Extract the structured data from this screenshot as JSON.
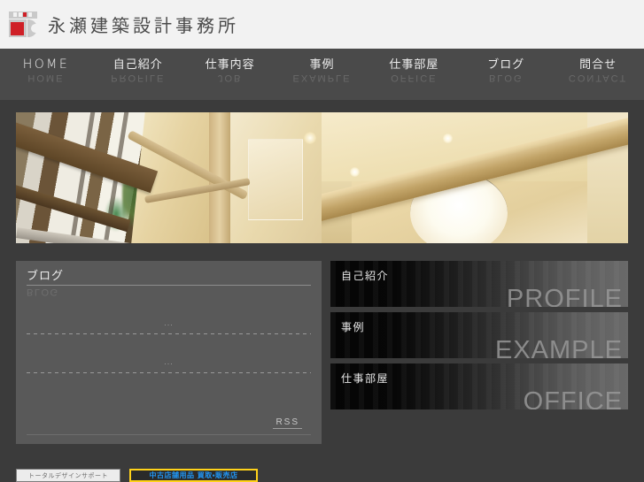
{
  "header": {
    "site_title": "永瀬建築設計事務所",
    "logo_icon": "architect-logo-mark"
  },
  "nav": {
    "items": [
      {
        "ja": "HOME",
        "en": "HOME",
        "is_en": true
      },
      {
        "ja": "自己紹介",
        "en": "PROFILE",
        "is_en": false
      },
      {
        "ja": "仕事内容",
        "en": "JOB",
        "is_en": false
      },
      {
        "ja": "事例",
        "en": "EXAMPLE",
        "is_en": false
      },
      {
        "ja": "仕事部屋",
        "en": "OFFICE",
        "is_en": false
      },
      {
        "ja": "ブログ",
        "en": "BLOG",
        "is_en": false
      },
      {
        "ja": "問合せ",
        "en": "CONTACT",
        "is_en": false
      }
    ]
  },
  "hero": {
    "left_alt": "architectural-interior-glass-facade",
    "right_alt": "architectural-interior-ceiling-beam"
  },
  "blog": {
    "title": "ブログ",
    "subtitle": "BLOG",
    "entries": [
      {
        "text": "..."
      },
      {
        "text": "..."
      }
    ],
    "rss_label": "RSS"
  },
  "panels": [
    {
      "ja": "自己紹介",
      "en": "PROFILE"
    },
    {
      "ja": "事例",
      "en": "EXAMPLE"
    },
    {
      "ja": "仕事部屋",
      "en": "OFFICE"
    }
  ],
  "banners": [
    {
      "label": "トータルデザインサポート",
      "style": "light"
    },
    {
      "label": "中古店舗用品 買取・販売店",
      "style": "yellow"
    }
  ],
  "colors": {
    "header_bg": "#f2f2f2",
    "nav_bg": "#4a4a4a",
    "page_bg": "#3b3b3b",
    "panel_bg": "#595959",
    "accent_red": "#cf2027",
    "banner_yellow": "#ffd21a",
    "banner_blue": "#2196f3"
  }
}
